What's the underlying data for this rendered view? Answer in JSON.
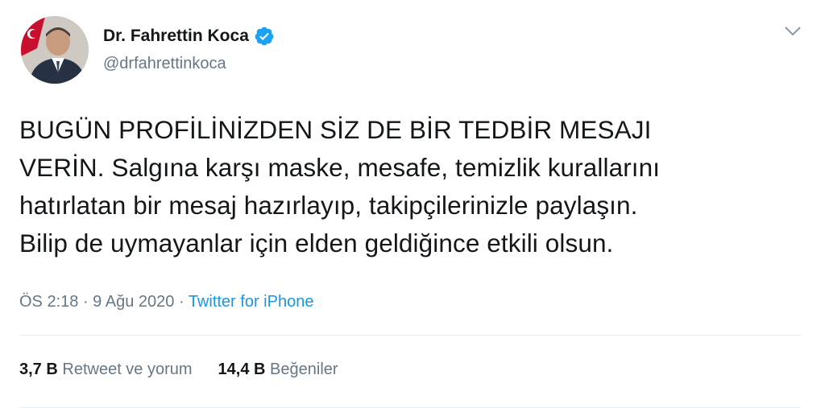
{
  "author": {
    "display_name": "Dr. Fahrettin Koca",
    "handle": "@drfahrettinkoca",
    "verified_icon": "verified-badge-icon",
    "avatar_icon": "profile-photo"
  },
  "menu": {
    "icon": "chevron-down-icon"
  },
  "tweet": {
    "text": "BUGÜN PROFİLİNİZDEN SİZ DE BİR TEDBİR MESAJI\nVERİN. Salgına karşı maske, mesafe, temizlik kurallarını\nhatırlatan bir mesaj hazırlayıp, takipçilerinizle paylaşın.\nBilip de uymayanlar için elden geldiğince etkili olsun."
  },
  "meta": {
    "time": "ÖS 2:18",
    "separator": " · ",
    "date": "9 Ağu 2020",
    "separator2": " · ",
    "source": "Twitter for iPhone"
  },
  "stats": {
    "retweets_count": "3,7 B",
    "retweets_label": "Retweet ve yorum",
    "likes_count": "14,4 B",
    "likes_label": "Beğeniler"
  },
  "colors": {
    "text": "#14171a",
    "secondary": "#657786",
    "link": "#1b95e0",
    "verified": "#1da1f2",
    "divider": "#e6ecf0"
  }
}
